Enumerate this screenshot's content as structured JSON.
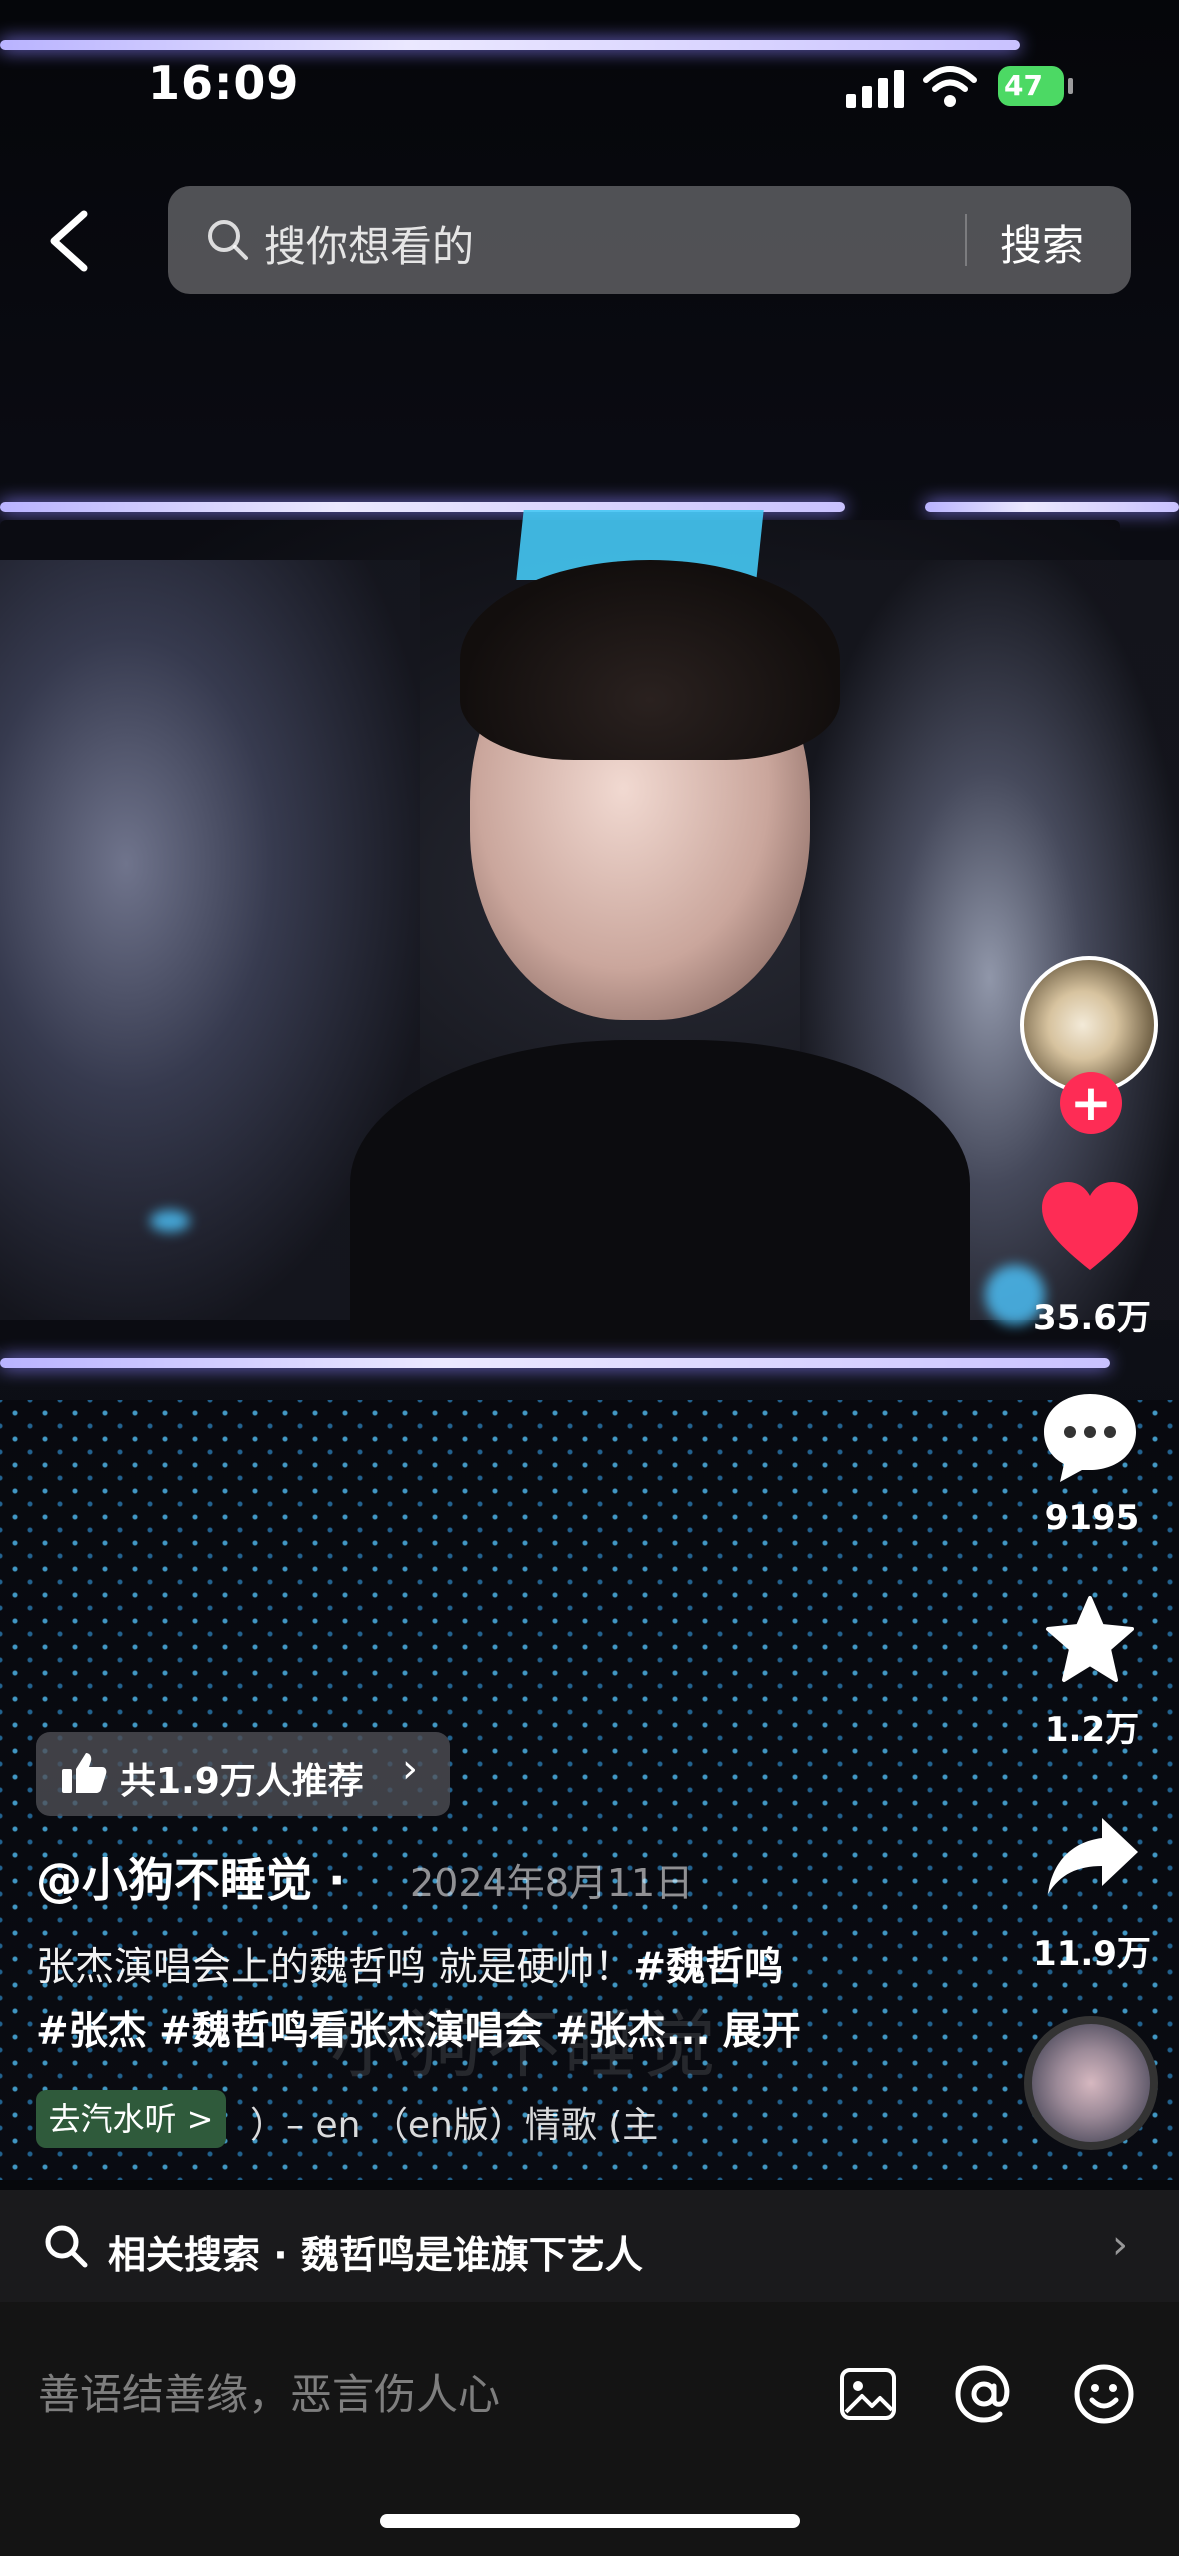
{
  "status_bar": {
    "time": "16:09",
    "battery": "47"
  },
  "search": {
    "placeholder": "搜你想看的",
    "button_label": "搜索"
  },
  "video": {
    "watermark": "小狗不睡觉"
  },
  "actions": {
    "like_count": "35.6万",
    "comment_count": "9195",
    "favorite_count": "1.2万",
    "share_count": "11.9万"
  },
  "info": {
    "recommend": "共1.9万人推荐",
    "author": "@小狗不睡觉 ·",
    "date": "2024年8月11日",
    "desc_line1": {
      "text": "张杰演唱会上的魏哲鸣 就是硬帅！",
      "tag": "#魏哲鸣"
    },
    "desc_line2": {
      "tag1": "#张杰",
      "tag2": "#魏哲鸣看张杰演唱会",
      "tag3": "#张杰...",
      "expand": "展开"
    },
    "music_pill": "去汽水听 >",
    "music_title": "）– en （en版）情歌 (主"
  },
  "related": {
    "text": "相关搜索 · 魏哲鸣是谁旗下艺人"
  },
  "comment": {
    "placeholder": "善语结善缘，恶言伤人心"
  },
  "colors": {
    "like_red": "#fe2c55",
    "battery_green": "#4cd964",
    "music_pill_green": "#2f5a3b"
  },
  "icons": [
    "back-icon",
    "search-icon",
    "heart-icon",
    "comment-icon",
    "star-icon",
    "share-icon",
    "thumbs-up-icon",
    "image-icon",
    "at-icon",
    "emoji-icon",
    "wifi-icon",
    "signal-icon"
  ]
}
